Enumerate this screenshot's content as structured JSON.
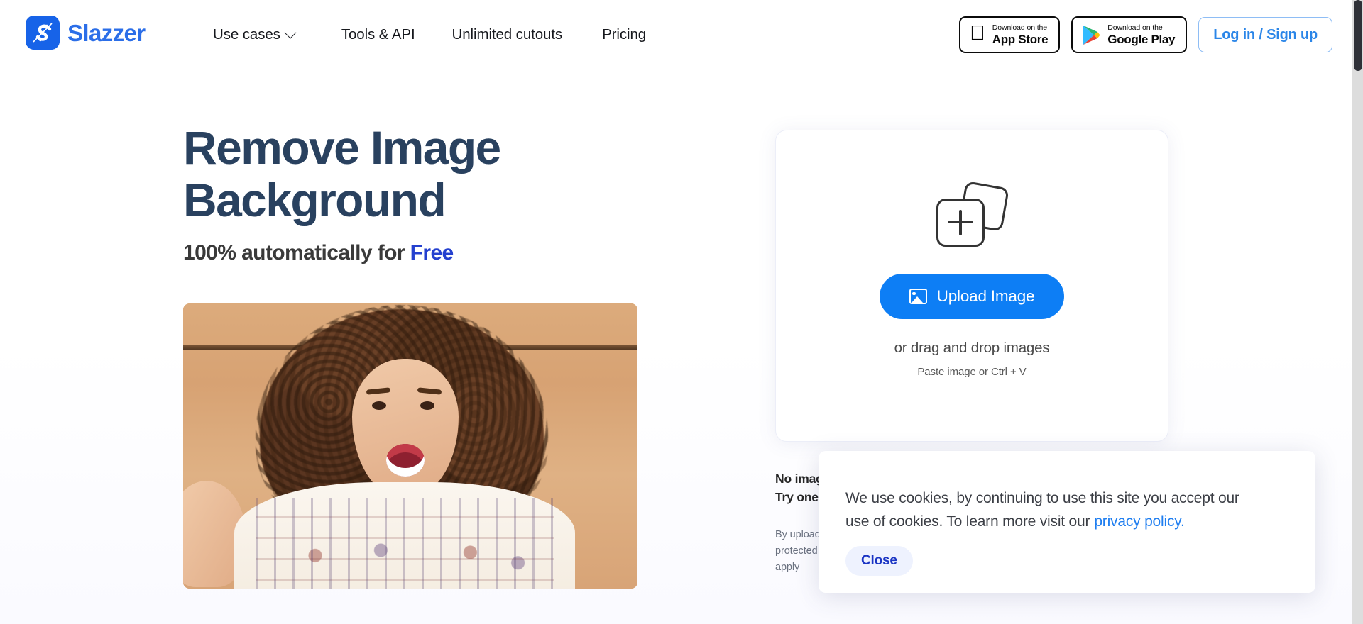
{
  "brand": {
    "name": "Slazzer",
    "logo_icon": "slazzer-s-logo-icon",
    "accent": "#2b6ee8"
  },
  "nav": {
    "items": [
      {
        "label": "Use cases",
        "has_dropdown": true,
        "chevron_icon": "chevron-down-icon"
      },
      {
        "label": "Tools & API",
        "has_dropdown": false
      },
      {
        "label": "Unlimited cutouts",
        "has_dropdown": false
      },
      {
        "label": "Pricing",
        "has_dropdown": false
      }
    ]
  },
  "header_actions": {
    "app_store": {
      "icon": "apple-icon",
      "small": "Download on the",
      "big": "App Store"
    },
    "google_play": {
      "icon": "google-play-icon",
      "small": "Download on the",
      "big": "Google Play"
    },
    "login": {
      "label": "Log in / Sign up",
      "color": "#2b86e8"
    }
  },
  "hero": {
    "title_line1": "Remove Image",
    "title_line2": "Background",
    "title_color": "#29415f",
    "subtitle_prefix": "100% automatically for ",
    "subtitle_highlight": "Free",
    "subtitle_highlight_color": "#2440cf",
    "photo_alt": "smiling woman with curly hair in front of a tan wall"
  },
  "upload": {
    "icon": "add-images-icon",
    "button_label": "Upload Image",
    "button_icon": "image-icon",
    "button_color": "#0d7ef5",
    "drag_text": "or drag and drop images",
    "paste_text": "Paste image or Ctrl + V"
  },
  "below_card": {
    "no_image_line1": "No image?",
    "no_image_line2": "Try one of these",
    "legal_line1": "By uploading an image or URL you agree to our Terms of Service. This site is",
    "legal_line2": "protected by reCAPTCHA and the Google Privacy Policy and Terms of Service",
    "legal_line3": "apply"
  },
  "cookie_banner": {
    "text_part1": "We use cookies, by continuing to use this site you accept our",
    "text_part2": "use of cookies.  To learn more visit our",
    "link_label": "privacy policy.",
    "link_color": "#1f7ef0",
    "close_label": "Close",
    "close_text_color": "#1b35c4",
    "close_bg": "#eef2fe"
  },
  "scrollbar": {
    "thumb_name": "vertical-scrollbar-thumb"
  }
}
